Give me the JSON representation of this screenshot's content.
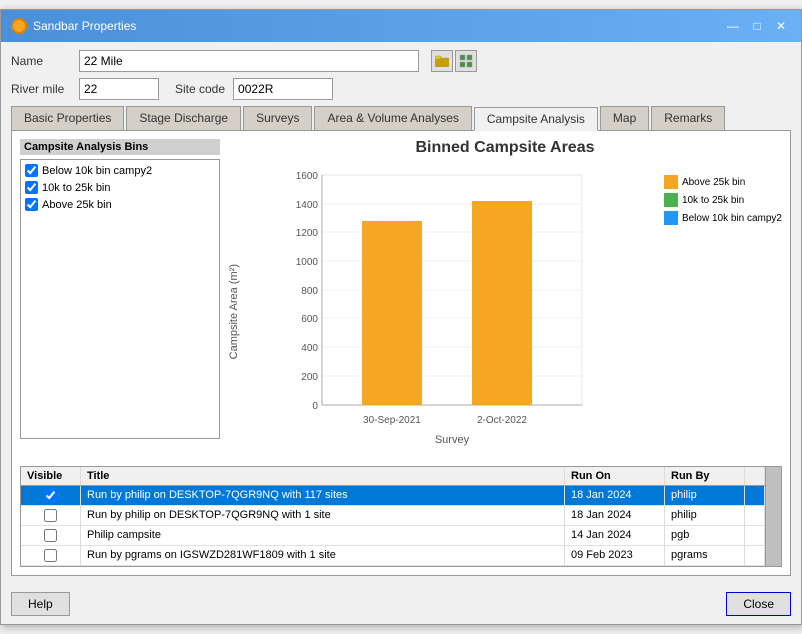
{
  "window": {
    "title": "Sandbar Properties",
    "controls": {
      "minimize": "—",
      "maximize": "□",
      "close": "✕"
    }
  },
  "form": {
    "name_label": "Name",
    "name_value": "22 Mile",
    "river_mile_label": "River mile",
    "river_mile_value": "22",
    "site_code_label": "Site code",
    "site_code_value": "0022R"
  },
  "tabs": [
    {
      "id": "basic",
      "label": "Basic Properties",
      "active": false
    },
    {
      "id": "stage",
      "label": "Stage Discharge",
      "active": false
    },
    {
      "id": "surveys",
      "label": "Surveys",
      "active": false
    },
    {
      "id": "area",
      "label": "Area & Volume Analyses",
      "active": false
    },
    {
      "id": "campsite",
      "label": "Campsite Analysis",
      "active": true
    },
    {
      "id": "map",
      "label": "Map",
      "active": false
    },
    {
      "id": "remarks",
      "label": "Remarks",
      "active": false
    }
  ],
  "campsite": {
    "bins_label": "Campsite Analysis Bins",
    "bins": [
      {
        "label": "Below 10k bin campy2",
        "checked": true
      },
      {
        "label": "10k to 25k bin",
        "checked": true
      },
      {
        "label": "Above 25k bin",
        "checked": true
      }
    ],
    "chart_title": "Binned Campsite Areas",
    "y_axis_label": "Campsite Area (m²)",
    "x_axis_label": "Survey",
    "y_ticks": [
      "0",
      "200",
      "400",
      "600",
      "800",
      "1000",
      "1200",
      "1400",
      "1600"
    ],
    "bars": [
      {
        "survey": "30-Sep-2021",
        "value": 1280,
        "color": "#f5a623"
      },
      {
        "survey": "2-Oct-2022",
        "value": 1420,
        "color": "#f5a623"
      }
    ],
    "legend": [
      {
        "label": "Above 25k bin",
        "color": "#f5a623"
      },
      {
        "label": "10k to 25k bin",
        "color": "#4caf50"
      },
      {
        "label": "Below 10k bin campy2",
        "color": "#2196f3"
      }
    ],
    "table": {
      "headers": [
        "Visible",
        "Title",
        "Run On",
        "Run By"
      ],
      "rows": [
        {
          "visible": true,
          "title": "Run by philip on DESKTOP-7QGR9NQ with 117 sites",
          "run_on": "18 Jan 2024",
          "run_by": "philip",
          "selected": true
        },
        {
          "visible": false,
          "title": "Run by philip on DESKTOP-7QGR9NQ with 1 site",
          "run_on": "18 Jan 2024",
          "run_by": "philip",
          "selected": false
        },
        {
          "visible": false,
          "title": "Philip campsite",
          "run_on": "14 Jan 2024",
          "run_by": "pgb",
          "selected": false
        },
        {
          "visible": false,
          "title": "Run by pgrams on IGSWZD281WF1809 with 1 site",
          "run_on": "09 Feb 2023",
          "run_by": "pgrams",
          "selected": false
        }
      ]
    }
  },
  "buttons": {
    "help": "Help",
    "close": "Close"
  }
}
